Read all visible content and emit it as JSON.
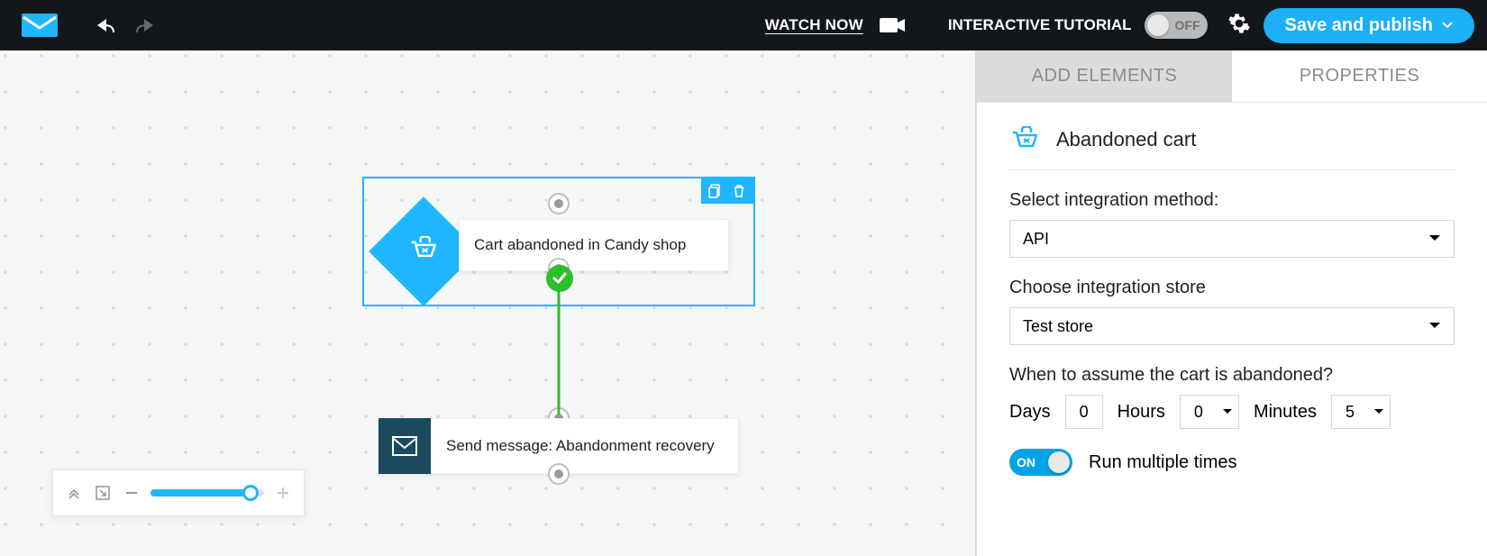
{
  "topbar": {
    "watch_label": "WATCH NOW",
    "tutorial_label": "INTERACTIVE TUTORIAL",
    "tutorial_toggle_text": "OFF",
    "publish_label": "Save and publish"
  },
  "workflow": {
    "node_trigger_label": "Cart abandoned in Candy shop",
    "node_action_label": "Send message: Abandonment recovery"
  },
  "sidebar": {
    "tab_add": "ADD ELEMENTS",
    "tab_props": "PROPERTIES",
    "header_title": "Abandoned cart",
    "integration_method_label": "Select integration method:",
    "integration_method_value": "API",
    "integration_store_label": "Choose integration store",
    "integration_store_value": "Test store",
    "abandon_time_label": "When to assume the cart is abandoned?",
    "days_label": "Days",
    "days_value": "0",
    "hours_label": "Hours",
    "hours_value": "0",
    "minutes_label": "Minutes",
    "minutes_value": "5",
    "run_toggle_text": "ON",
    "run_label": "Run multiple times"
  },
  "colors": {
    "accent": "#1fb6ff",
    "dark": "#13161a",
    "green": "#2bbf2b",
    "teal": "#1b4a5c"
  }
}
